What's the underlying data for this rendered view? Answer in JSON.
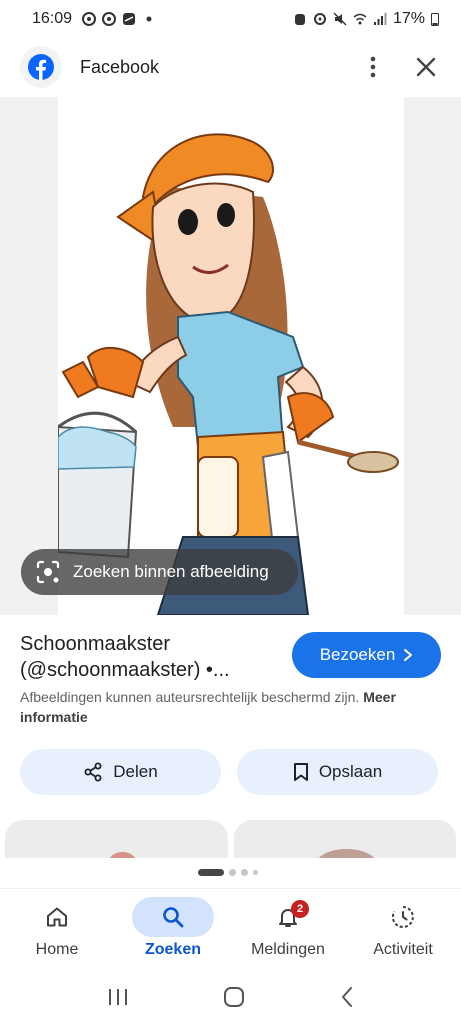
{
  "status_bar": {
    "time": "16:09",
    "battery": "17%",
    "icons": [
      "chrome-icon",
      "chrome-icon",
      "app-icon",
      "dot-icon",
      "alarm-icon",
      "nfc-icon",
      "mute-icon",
      "wifi-icon",
      "signal-icon",
      "battery-icon"
    ]
  },
  "header": {
    "title": "Facebook",
    "icons": [
      "facebook-logo-icon",
      "more-vert-icon",
      "close-icon"
    ]
  },
  "image": {
    "lens_label": "Zoeken binnen afbeelding"
  },
  "result": {
    "title_line1": "Schoonmaakster",
    "title_line2": "(@schoonmaakster) •...",
    "visit_label": "Bezoeken",
    "copyright_text": "Afbeeldingen kunnen auteursrechtelijk beschermd zijn.",
    "copyright_link": "Meer informatie",
    "share_label": "Delen",
    "save_label": "Opslaan"
  },
  "carousel": {
    "count": 4,
    "active_index": 0
  },
  "bottom_nav": {
    "items": [
      {
        "label": "Home",
        "icon": "home-icon"
      },
      {
        "label": "Zoeken",
        "icon": "search-icon",
        "active": true
      },
      {
        "label": "Meldingen",
        "icon": "bell-icon",
        "badge": "2"
      },
      {
        "label": "Activiteit",
        "icon": "activity-icon"
      }
    ]
  },
  "colors": {
    "accent": "#1a73e8",
    "active_nav_bg": "#d3e3fd",
    "action_bg": "#e8f0fe",
    "badge": "#c5221f"
  }
}
